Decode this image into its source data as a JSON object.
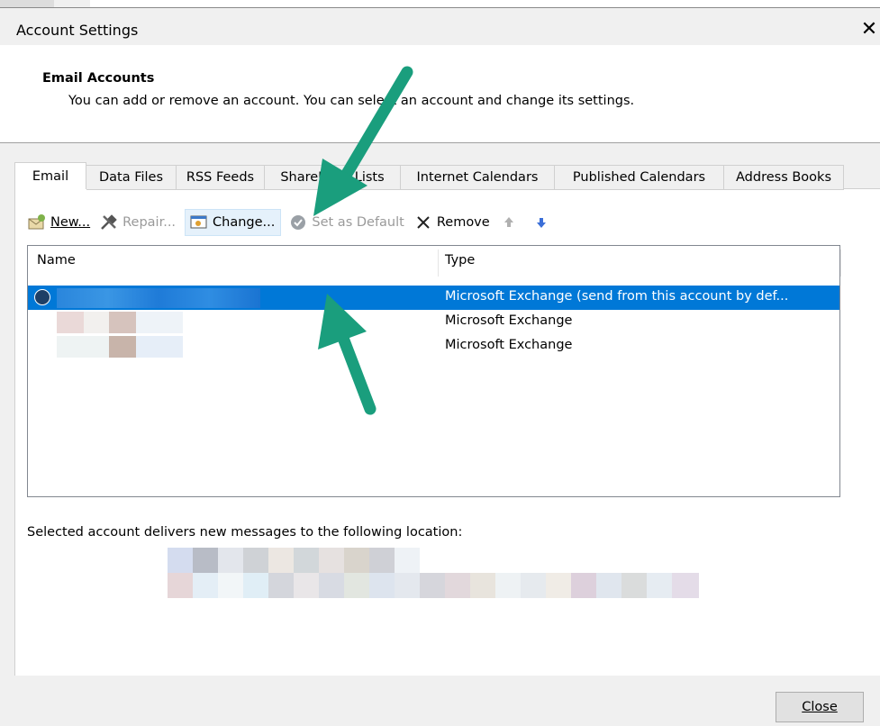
{
  "dialog": {
    "title": "Account Settings",
    "close_glyph": "✕"
  },
  "header": {
    "title": "Email Accounts",
    "subtitle": "You can add or remove an account. You can select an account and change its settings."
  },
  "tabs": [
    {
      "label": "Email",
      "active": true
    },
    {
      "label": "Data Files",
      "active": false
    },
    {
      "label": "RSS Feeds",
      "active": false
    },
    {
      "label": "SharePoint Lists",
      "active": false
    },
    {
      "label": "Internet Calendars",
      "active": false
    },
    {
      "label": "Published Calendars",
      "active": false
    },
    {
      "label": "Address Books",
      "active": false
    }
  ],
  "toolbar": {
    "new_label": "New...",
    "repair_label": "Repair...",
    "change_label": "Change...",
    "set_default_label": "Set as Default",
    "remove_label": "Remove",
    "new_icon": "new-account-icon",
    "repair_icon": "repair-tools-icon",
    "change_icon": "change-settings-icon",
    "set_default_icon": "checkmark-circle-icon",
    "remove_icon": "x-icon",
    "up_icon": "arrow-up-icon",
    "down_icon": "arrow-down-icon"
  },
  "accounts_table": {
    "columns": [
      "Name",
      "Type"
    ],
    "rows": [
      {
        "name": "",
        "type": "Microsoft Exchange (send from this account by def...",
        "selected": true,
        "default": true
      },
      {
        "name": "",
        "type": "Microsoft Exchange",
        "selected": false,
        "default": false
      },
      {
        "name": "",
        "type": "Microsoft Exchange",
        "selected": false,
        "default": false
      }
    ]
  },
  "delivery": {
    "label": "Selected account delivers new messages to the following location:"
  },
  "footer": {
    "close_label": "Close"
  },
  "colors": {
    "selection": "#0078d7",
    "annotation_arrow": "#1a9e7d",
    "dialog_bg": "#f0f0f0"
  }
}
